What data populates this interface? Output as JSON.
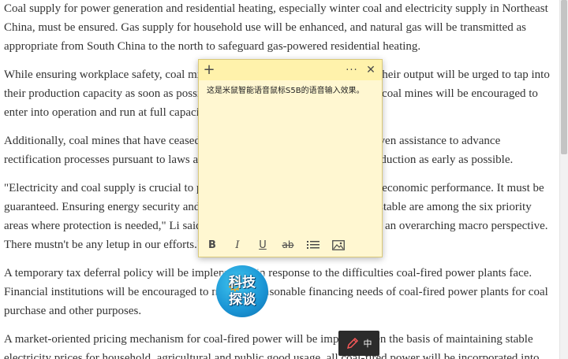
{
  "article": {
    "paragraphs": [
      "Coal supply for power generation and residential heating, especially winter coal and electricity supply in Northeast China, must be ensured. Gas supply for household use will be enhanced, and natural gas will be transmitted as appropriate from South China to the north to safeguard gas-powered residential heating.",
      "While ensuring workplace safety, coal mines that have the capacity to increase their output will be urged to tap into their production capacity as soon as possible. Approval procedures for open-pit coal mines will be encouraged to enter into operation and run at full capacity.",
      "Additionally, coal mines that have ceased production for rectification will be given assistance to advance rectification processes pursuant to laws and regulations, so they can resume production as early as possible.",
      "\"Electricity and coal supply is crucial to people's lives and the country's overall economic performance. It must be guaranteed. Ensuring energy security and keeping industrial and supply chains stable are among the six priority areas where protection is needed,\" Li said. \"We must take this as a priority from an overarching macro perspective. There mustn't be any letup in our efforts.\"",
      "A temporary tax deferral policy will be implemented in response to the difficulties coal-fired power plants face. Financial institutions will be encouraged to meet the reasonable financing needs of coal-fired power plants for coal purchase and other purposes.",
      "A market-oriented pricing mechanism for coal-fired power will be improved. On the basis of maintaining stable electricity prices for household, agricultural and public good usage, all coal-fired power will be incorporated into"
    ]
  },
  "sticky_note": {
    "add_icon": "+",
    "more_icon": "···",
    "close_icon": "✕",
    "text": "这是米鼠智能语音鼠标S5B的语音输入效果。",
    "toolbar": {
      "bold": "B",
      "italic": "I",
      "underline": "U",
      "strikethrough": "ab"
    }
  },
  "watermark": {
    "line1": "科技",
    "line2": "探谈"
  },
  "ime": {
    "mode": "中"
  },
  "colors": {
    "note_bg": "#fff7d1",
    "note_title": "#fff2ab",
    "text": "#333333"
  }
}
